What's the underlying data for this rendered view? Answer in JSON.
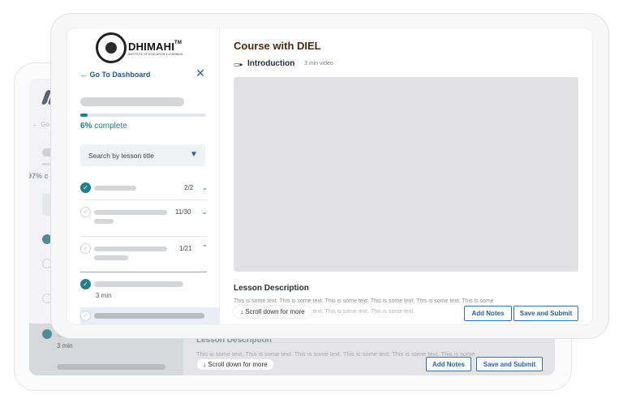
{
  "back": {
    "go_label": "← Go",
    "percent_label": "97% c",
    "duration": "3 min",
    "lesson_description_title": "Lesson Description",
    "description_text": "This is some text. This is some text. This is some text. This is some text. This is some text. This is some",
    "scroll_label": "Scroll down for more",
    "add_notes_label": "Add Notes",
    "save_submit_label": "Save and Submit"
  },
  "sidebar": {
    "logo": {
      "name": "DHIMAHI",
      "tm": "TM",
      "tagline": "INSTITUTE OF EDUCATION & LEARNING"
    },
    "go_to_dashboard": "Go To Dashboard",
    "progress": {
      "percent_value": 6,
      "percent": "6%",
      "suffix": " complete"
    },
    "search": {
      "placeholder": "Search by lesson title"
    },
    "sections": [
      {
        "count": "2/2",
        "completed": true,
        "expanded": false
      },
      {
        "count": "11/30",
        "completed": false,
        "expanded": false
      },
      {
        "count": "1/21",
        "completed": false,
        "expanded": true
      }
    ],
    "lessons": [
      {
        "duration": "3 min",
        "completed": true
      }
    ]
  },
  "main": {
    "course_title": "Course with DIEL",
    "lesson": {
      "title": "Introduction",
      "meta": "3 min video"
    },
    "description_title": "Lesson Description",
    "description_text": "This is some text. This is some text. This is some text. This is some text. This is some text. This is some",
    "description_text_2": "This is some text. This is some text. This is some text. This is some text.",
    "scroll_label": "Scroll down for more",
    "buttons": {
      "add_notes": "Add Notes",
      "save_submit": "Save and Submit"
    }
  },
  "colors": {
    "accent": "#1f7f8a",
    "link": "#2b5fa0",
    "title": "#4a2b12"
  }
}
